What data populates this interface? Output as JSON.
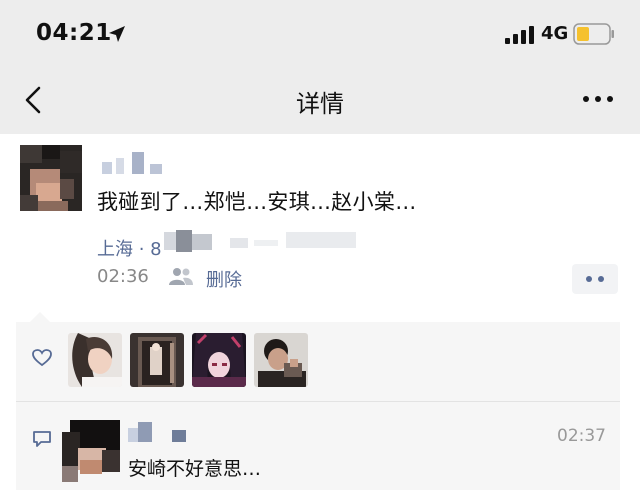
{
  "status_bar": {
    "time": "04:21",
    "network": "4G",
    "icons": [
      "location-arrow-icon",
      "signal-icon",
      "battery-icon"
    ],
    "battery_color": "#f5c12e"
  },
  "nav": {
    "title": "详情",
    "back_icon": "chevron-left-icon",
    "more_icon": "more-dots-icon"
  },
  "post": {
    "text": "我碰到了…郑恺…安琪…赵小棠…",
    "location": "上海 · 8",
    "time": "02:36",
    "delete_label": "删除",
    "privacy_icon": "friends-icon",
    "link_color": "#576b95"
  },
  "likes": {
    "icon": "heart-icon",
    "avatars": [
      "liker-avatar-1",
      "liker-avatar-2",
      "liker-avatar-3",
      "liker-avatar-4"
    ]
  },
  "comments": [
    {
      "text": "安崎不好意思…",
      "time": "02:37",
      "icon": "comment-bubble-icon"
    }
  ]
}
